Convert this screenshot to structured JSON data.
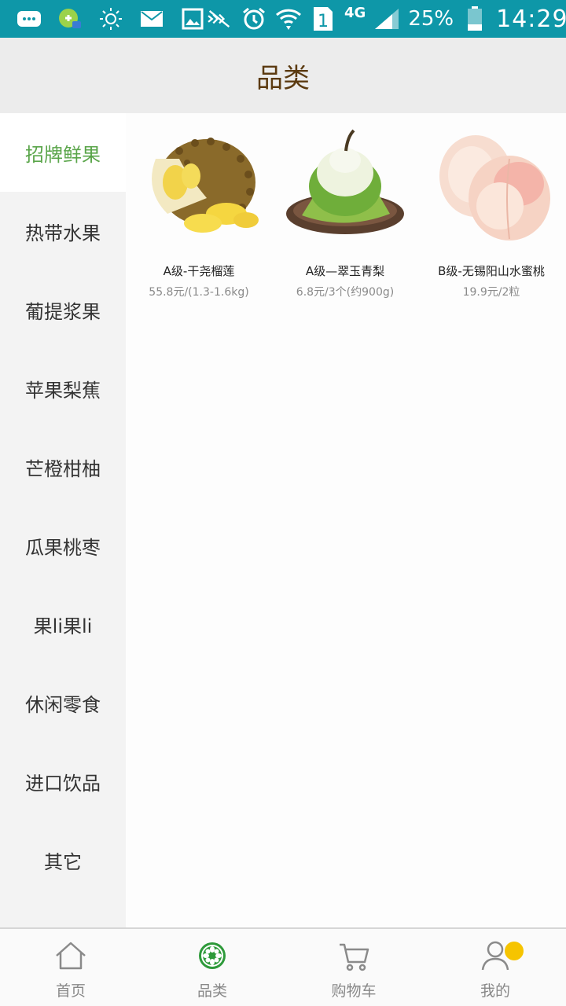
{
  "status_bar": {
    "network": "4G",
    "sim": "1",
    "battery": "25%",
    "time": "14:29",
    "icons": [
      "messages-icon",
      "app-notification-icon",
      "brightness-icon",
      "mail-icon",
      "gallery-icon",
      "mute-icon",
      "alarm-icon",
      "wifi-icon",
      "sim-icon",
      "signal-icon",
      "battery-icon"
    ]
  },
  "header": {
    "title": "品类"
  },
  "sidebar": {
    "items": [
      {
        "label": "招牌鲜果",
        "active": true
      },
      {
        "label": "热带水果"
      },
      {
        "label": "葡提浆果"
      },
      {
        "label": "苹果梨蕉"
      },
      {
        "label": "芒橙柑柚"
      },
      {
        "label": "瓜果桃枣"
      },
      {
        "label": "果li果li"
      },
      {
        "label": "休闲零食"
      },
      {
        "label": "进口饮品"
      },
      {
        "label": "其它"
      }
    ]
  },
  "products": [
    {
      "name": "A级-干尧榴莲",
      "price": "55.8元/(1.3-1.6kg)",
      "image": "durian"
    },
    {
      "name": "A级—翠玉青梨",
      "price": "6.8元/3个(约900g)",
      "image": "green-pear"
    },
    {
      "name": "B级-无锡阳山水蜜桃",
      "price": "19.9元/2粒",
      "image": "peach"
    }
  ],
  "bottom_nav": {
    "items": [
      {
        "label": "首页",
        "icon": "home-icon"
      },
      {
        "label": "品类",
        "icon": "category-icon",
        "active": true
      },
      {
        "label": "购物车",
        "icon": "cart-icon"
      },
      {
        "label": "我的",
        "icon": "profile-icon",
        "badge": true
      }
    ]
  },
  "colors": {
    "status_bar": "#0e97a8",
    "title": "#5b3a10",
    "active_category": "#5aa54a",
    "badge": "#f6c400"
  }
}
